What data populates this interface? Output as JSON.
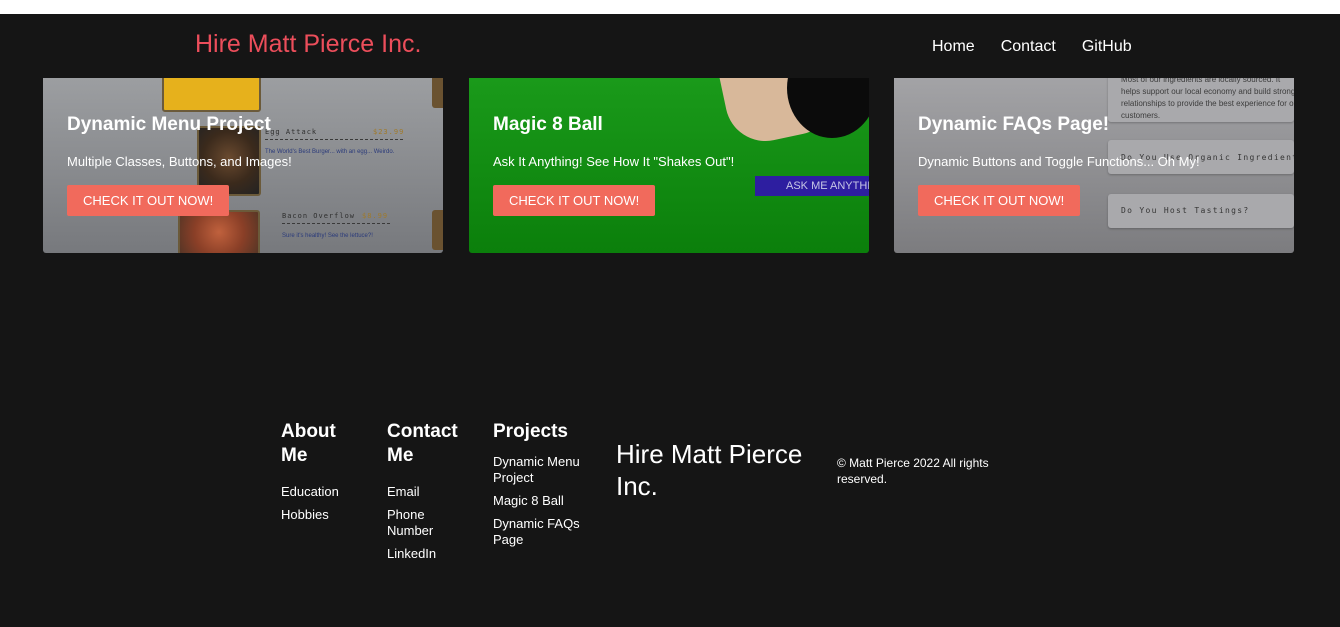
{
  "header": {
    "brand": "Hire Matt Pierce Inc.",
    "nav": [
      "Home",
      "Contact",
      "GitHub"
    ]
  },
  "projects": [
    {
      "title": "Dynamic Menu Project",
      "description": "Multiple Classes, Buttons, and Images!",
      "button": "CHECK IT OUT NOW!",
      "preview": {
        "item_1": "Egg Attack",
        "price_1": "$23.99",
        "desc_1": "The World's Best Burger... with an egg... Weirdo.",
        "item_2": "Bacon Overflow",
        "price_2": "$8.99",
        "desc_2": "Sure it's healthy! See the lettuce?!"
      }
    },
    {
      "title": "Magic 8 Ball",
      "description": "Ask It Anything! See How It \"Shakes Out\"!",
      "button": "CHECK IT OUT NOW!",
      "preview": {
        "ask_button": "ASK ME ANYTHING"
      }
    },
    {
      "title": "Dynamic FAQs Page!",
      "description": "Dynamic Buttons and Toggle Functions... Oh My!",
      "button": "CHECK IT OUT NOW!",
      "preview": {
        "answer": "Most of our ingredients are locally sourced. It helps support our local economy and build strong relationships to provide the best experience for our customers.",
        "question_1": "Do You Use Organic Ingredients?",
        "question_2": "Do You Host Tastings?"
      }
    }
  ],
  "footer": {
    "about": {
      "heading": "About Me",
      "links": [
        "Education",
        "Hobbies"
      ]
    },
    "contact": {
      "heading": "Contact Me",
      "links": [
        "Email",
        "Phone Number",
        "LinkedIn"
      ]
    },
    "projects": {
      "heading": "Projects",
      "links": [
        "Dynamic Menu Project",
        "Magic 8 Ball",
        "Dynamic FAQs Page"
      ]
    },
    "brand": "Hire Matt Pierce Inc.",
    "copyright": "© Matt Pierce 2022 All rights reserved."
  },
  "colors": {
    "background": "#151515",
    "brand": "#ec4e5b",
    "button": "#f16a5c",
    "card_green": "#1a9a1a"
  }
}
